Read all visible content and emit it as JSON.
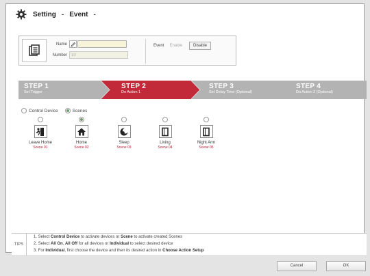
{
  "window": {
    "title_section": "Setting",
    "title_separator": "-",
    "title_page": "Event",
    "title_trailing": "-"
  },
  "info": {
    "name_label": "Name",
    "name_value": "",
    "number_label": "Number",
    "number_value": "10",
    "event_label": "Event",
    "enable_label": "Enable",
    "disable_label": "Disable"
  },
  "steps": [
    {
      "title": "STEP 1",
      "subtitle": "Set Trigger",
      "state": "done"
    },
    {
      "title": "STEP 2",
      "subtitle": "Do Action 1",
      "state": "active"
    },
    {
      "title": "STEP 3",
      "subtitle": "Set Delay Time (Optional)",
      "state": "pending"
    },
    {
      "title": "STEP 4",
      "subtitle": "Do Action 2 (Optional)",
      "state": "pending"
    }
  ],
  "action_type": {
    "control_device_label": "Control Device",
    "scenes_label": "Scenes",
    "selected": "Scenes"
  },
  "scenes": [
    {
      "name": "Leave Home",
      "id": "Scene 01",
      "icon": "leave-home-icon",
      "selected": false
    },
    {
      "name": "Home",
      "id": "Scene 02",
      "icon": "home-icon",
      "selected": true
    },
    {
      "name": "Sleep",
      "id": "Scene 03",
      "icon": "sleep-icon",
      "selected": false
    },
    {
      "name": "Living",
      "id": "Scene 04",
      "icon": "living-icon",
      "selected": false
    },
    {
      "name": "Night Arm",
      "id": "Scene 05",
      "icon": "night-arm-icon",
      "selected": false
    }
  ],
  "tips": {
    "label": "TIPS",
    "line1_prefix": "1. Select ",
    "line1_b1": "Control Device",
    "line1_mid": " to activate devices or ",
    "line1_b2": "Scene",
    "line1_suffix": " to activate created Scenes",
    "line2_prefix": "2. Select ",
    "line2_b1": "All On",
    "line2_sep": ", ",
    "line2_b2": "All Off",
    "line2_mid": " for all devices or ",
    "line2_b3": "Individual",
    "line2_suffix": " to select desired device",
    "line3_prefix": "3. For ",
    "line3_b1": "Individual",
    "line3_mid": ", first choose the device and then its desired action in ",
    "line3_b2": "Choose Action Setup"
  },
  "buttons": {
    "cancel_label": "Cancel",
    "ok_label": "OK"
  },
  "colors": {
    "step_active": "#c22a3a",
    "step_inactive": "#b3b3b3",
    "scene_id": "#b02030"
  }
}
